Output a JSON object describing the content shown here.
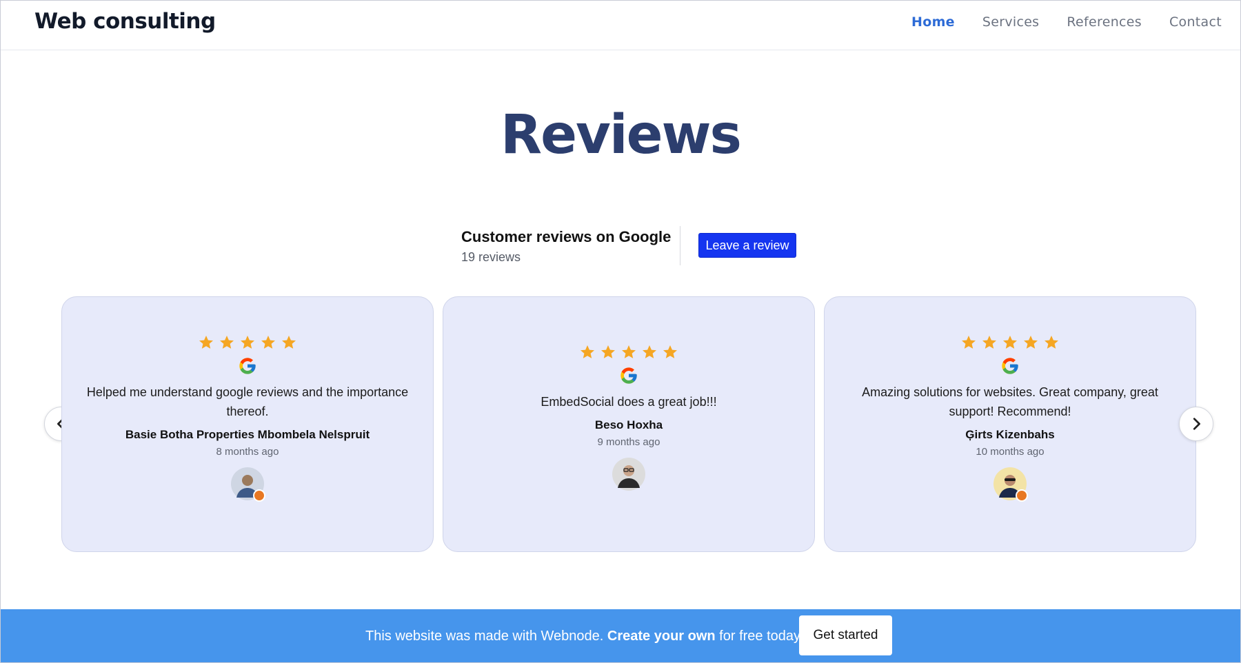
{
  "header": {
    "logo": "Web consulting",
    "nav": [
      {
        "label": "Home",
        "active": true
      },
      {
        "label": "Services",
        "active": false
      },
      {
        "label": "References",
        "active": false
      },
      {
        "label": "Contact",
        "active": false
      }
    ]
  },
  "main": {
    "title": "Reviews",
    "summary": {
      "title": "Customer reviews on Google",
      "count": "19 reviews",
      "leave_review_label": "Leave a review"
    },
    "reviews": [
      {
        "rating": 5,
        "text": "Helped me understand google reviews and the importance thereof.",
        "author": "Basie Botha Properties Mbombela Nelspruit",
        "time": "8 months ago"
      },
      {
        "rating": 5,
        "text": "EmbedSocial does a great job!!!",
        "author": "Beso Hoxha",
        "time": "9 months ago"
      },
      {
        "rating": 5,
        "text": "Amazing solutions for websites. Great company, great support! Recommend!",
        "author": "Ģirts Kizenbahs",
        "time": "10 months ago"
      }
    ]
  },
  "banner": {
    "text_before": "This website was made with Webnode. ",
    "text_bold": "Create your own",
    "text_after": " for free today!",
    "button_label": "Get started"
  },
  "colors": {
    "accent_nav": "#2d6bd6",
    "title": "#2c3e6e",
    "leave_button": "#1535f0",
    "card_bg": "#e7eafa",
    "star": "#f5a623",
    "banner_bg": "#4695ec"
  },
  "icons": [
    "star-icon",
    "google-logo-icon",
    "chevron-left-icon",
    "chevron-right-icon",
    "avatar"
  ]
}
